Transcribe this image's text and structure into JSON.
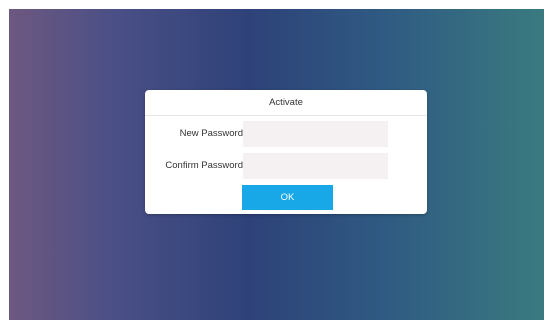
{
  "background": {
    "gradient_colors": [
      "#6d5880",
      "#2e4279",
      "#3a7a80"
    ]
  },
  "dialog": {
    "title": "Activate",
    "fields": [
      {
        "label": "New Password",
        "value": "",
        "placeholder": ""
      },
      {
        "label": "Confirm Password",
        "value": "",
        "placeholder": ""
      }
    ],
    "ok_label": "OK",
    "accent_color": "#18a8e8"
  }
}
